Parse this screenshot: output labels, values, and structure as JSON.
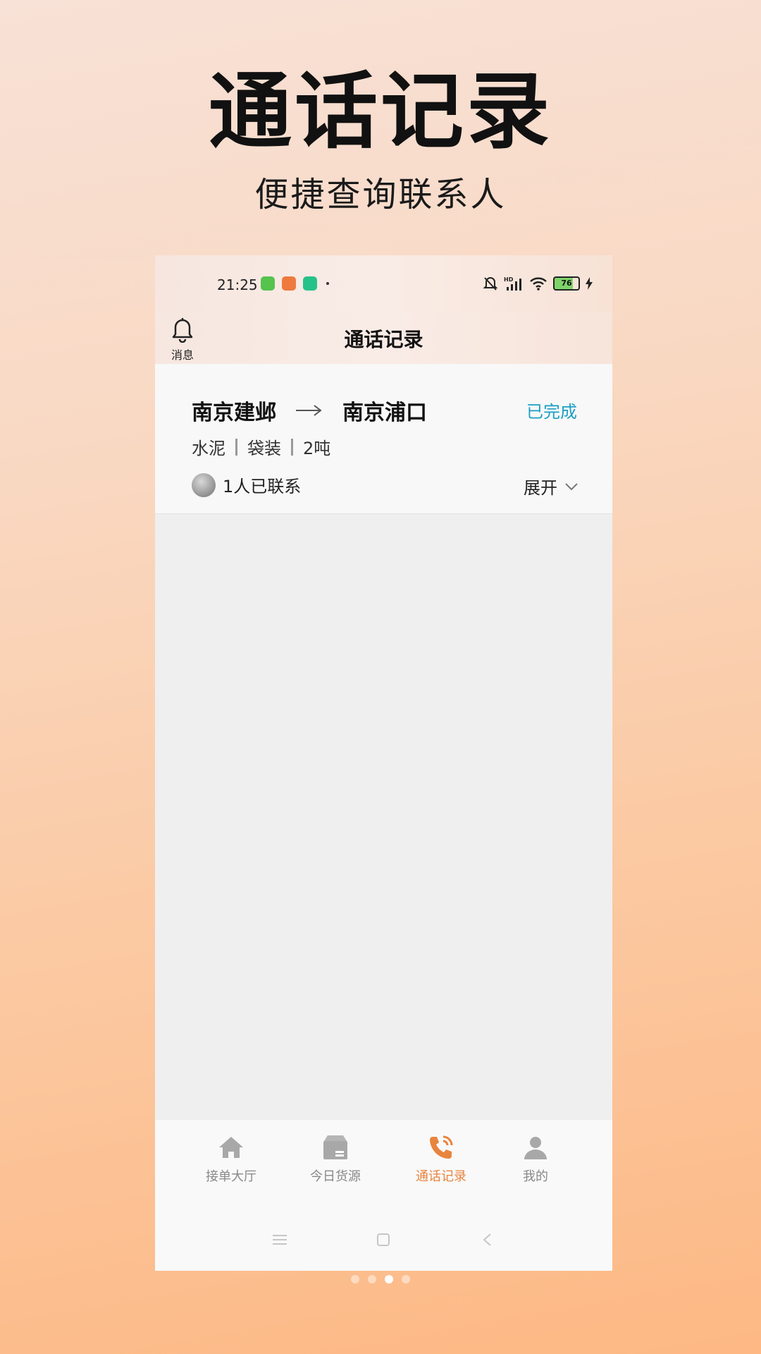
{
  "promo": {
    "title": "通话记录",
    "subtitle": "便捷查询联系人"
  },
  "status_bar": {
    "time": "21:25",
    "battery": "76"
  },
  "header": {
    "bell_label": "消息",
    "title": "通话记录"
  },
  "order": {
    "from": "南京建邺",
    "to": "南京浦口",
    "status": "已完成",
    "tags": [
      "水泥",
      "袋装",
      "2吨"
    ],
    "contacted": "1人已联系",
    "expand_label": "展开"
  },
  "tabs": [
    {
      "label": "接单大厅",
      "icon": "home-icon"
    },
    {
      "label": "今日货源",
      "icon": "box-icon"
    },
    {
      "label": "通话记录",
      "icon": "phone-icon",
      "active": true
    },
    {
      "label": "我的",
      "icon": "user-icon"
    }
  ],
  "pager": {
    "count": 4,
    "active_index": 2
  },
  "colors": {
    "status": "#1c9fc4",
    "active_tab": "#e8843e",
    "inactive_tab": "#888888"
  }
}
